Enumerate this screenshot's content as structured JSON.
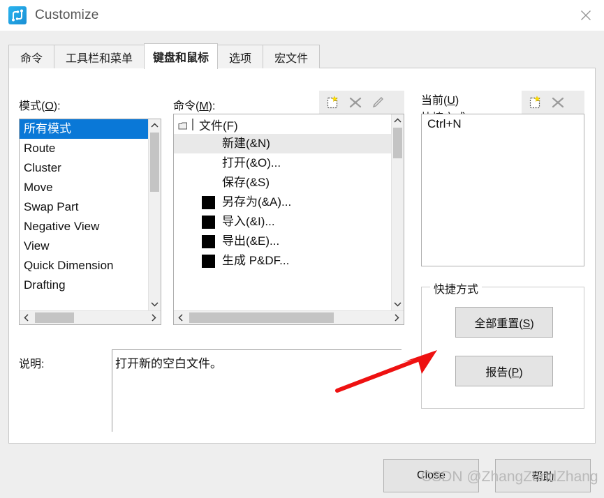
{
  "window": {
    "title": "Customize",
    "app_icon": "route-network-icon",
    "close_icon": "close-icon"
  },
  "tabs": [
    {
      "label": "命令",
      "active": false
    },
    {
      "label": "工具栏和菜单",
      "active": false
    },
    {
      "label": "键盘和鼠标",
      "active": true
    },
    {
      "label": "选项",
      "active": false
    },
    {
      "label": "宏文件",
      "active": false
    }
  ],
  "modes": {
    "label": "模式(O):",
    "label_main": "模式(",
    "label_key": "O",
    "label_tail": "):",
    "items": [
      {
        "label": "所有模式",
        "selected": true
      },
      {
        "label": "Route",
        "selected": false
      },
      {
        "label": "Cluster",
        "selected": false
      },
      {
        "label": "Move",
        "selected": false
      },
      {
        "label": "Swap Part",
        "selected": false
      },
      {
        "label": "Negative View",
        "selected": false
      },
      {
        "label": "View",
        "selected": false
      },
      {
        "label": "Quick Dimension",
        "selected": false
      },
      {
        "label": "Drafting",
        "selected": false
      }
    ],
    "scroll_up_icon": "chevron-up-icon",
    "scroll_down_icon": "chevron-down-icon",
    "scroll_left_icon": "chevron-left-icon",
    "scroll_right_icon": "chevron-right-icon"
  },
  "commands": {
    "label_main": "命令(",
    "label_key": "M",
    "label_tail": "):",
    "toolbar": [
      {
        "icon": "new-item-icon",
        "enabled": true
      },
      {
        "icon": "delete-x-icon",
        "enabled": false
      },
      {
        "icon": "edit-pencil-icon",
        "enabled": false
      }
    ],
    "root": {
      "label": "文件(F)",
      "icon": "document-icon"
    },
    "items": [
      {
        "label": "新建(&N)",
        "selected": true,
        "has_square": false
      },
      {
        "label": "打开(&O)...",
        "selected": false,
        "has_square": false
      },
      {
        "label": "保存(&S)",
        "selected": false,
        "has_square": false
      },
      {
        "label": "另存为(&A)...",
        "selected": false,
        "has_square": true
      },
      {
        "label": "导入(&I)...",
        "selected": false,
        "has_square": true
      },
      {
        "label": "导出(&E)...",
        "selected": false,
        "has_square": true
      },
      {
        "label": "生成 P&DF...",
        "selected": false,
        "has_square": true
      }
    ]
  },
  "current_shortcut": {
    "label_line1_main": "当前(",
    "label_line1_key": "U",
    "label_line1_tail": ")",
    "label_line2": "快捷方式:",
    "toolbar": [
      {
        "icon": "new-item-icon",
        "enabled": true
      },
      {
        "icon": "delete-x-icon",
        "enabled": false
      }
    ],
    "items": [
      "Ctrl+N"
    ]
  },
  "shortcut_group": {
    "title": "快捷方式",
    "reset_all_main": "全部重置(",
    "reset_all_key": "S",
    "reset_all_tail": ")",
    "report_main": "报告(",
    "report_key": "P",
    "report_tail": ")"
  },
  "description": {
    "label": "说明:",
    "text": "打开新的空白文件。"
  },
  "footer": {
    "close_label": "Close",
    "help_label": "帮助"
  },
  "annotation": {
    "arrow": "red-arrow-pointing-to-reset-all",
    "color": "#ee1111"
  },
  "watermark": {
    "text": "CSDN @ZhangZandZhang"
  }
}
